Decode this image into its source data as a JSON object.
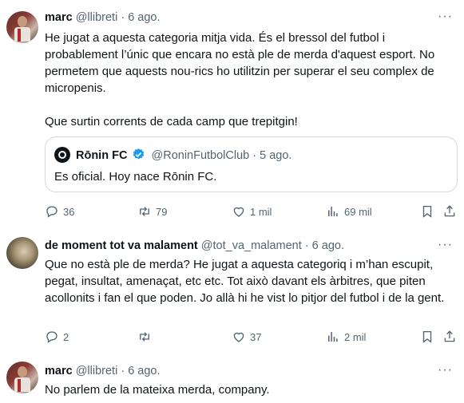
{
  "tweets": [
    {
      "name": "marc",
      "handle": "@llibreti",
      "dot": "·",
      "date": "6 ago.",
      "more": "···",
      "text_p1": "He jugat a aquesta categoria mitja vida. És el bressol del futbol i probablement l’únic que encara no està ple de merda d'aquest esport. No permetem que aquests nou-rics ho utilitzin per superar el seu complex de micropenis.",
      "text_p2": "Que surtin corrents de cada camp que trepitgin!",
      "quote": {
        "name": "Rōnin FC",
        "handle": "@RoninFutbolClub",
        "dot": "·",
        "date": "5 ago.",
        "text": "Es oficial. Hoy nace Rōnin FC."
      },
      "actions": {
        "replies": "36",
        "retweets": "79",
        "likes": "1 mil",
        "views": "69 mil"
      }
    },
    {
      "name": "de moment tot va malament",
      "handle": "@tot_va_malament",
      "dot": "·",
      "date": "6 ago.",
      "more": "···",
      "text": "Que no està ple de merda? He jugat a aquesta categoriq i m’han escupit, pegat, insultat, amenaçat, etc etc. Tot això davant els àrbitres, que piten acollonits i fan el que poden. Jo allà hi he vist lo pitjor del futbol i de la gent.",
      "actions": {
        "replies": "2",
        "retweets": "",
        "likes": "37",
        "views": "2 mil"
      }
    },
    {
      "name": "marc",
      "handle": "@llibreti",
      "dot": "·",
      "date": "6 ago.",
      "more": "···",
      "text": "No parlem de la mateixa merda, company."
    }
  ],
  "colors": {
    "text": "#0f1419",
    "secondary": "#536471",
    "verified": "#1d9bf0",
    "border": "#cfd9de"
  },
  "icons": [
    "reply-icon",
    "retweet-icon",
    "like-icon",
    "views-icon",
    "bookmark-icon",
    "share-icon",
    "more-icon",
    "verified-icon"
  ]
}
